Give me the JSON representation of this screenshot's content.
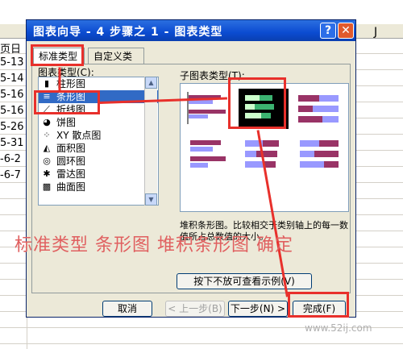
{
  "sheet": {
    "column_label": "J",
    "cells": [
      "页日",
      "5-13",
      "5-14",
      "5-16",
      "5-16",
      "5-26",
      "5-31",
      "-6-2",
      "-6-7"
    ]
  },
  "dialog": {
    "title": "图表向导 - 4 步骤之 1 - 图表类型",
    "help_glyph": "?",
    "close_glyph": "✕",
    "tabs": [
      "标准类型",
      "自定义类型"
    ],
    "chart_type_label": "图表类型(C):",
    "subtype_label": "子图表类型(T):",
    "chart_types": [
      {
        "label": "柱形图",
        "icon": "column-chart-icon"
      },
      {
        "label": "条形图",
        "icon": "bar-chart-icon"
      },
      {
        "label": "折线图",
        "icon": "line-chart-icon"
      },
      {
        "label": "饼图",
        "icon": "pie-chart-icon"
      },
      {
        "label": "XY 散点图",
        "icon": "scatter-chart-icon"
      },
      {
        "label": "面积图",
        "icon": "area-chart-icon"
      },
      {
        "label": "圆环图",
        "icon": "doughnut-chart-icon"
      },
      {
        "label": "雷达图",
        "icon": "radar-chart-icon"
      },
      {
        "label": "曲面图",
        "icon": "surface-chart-icon"
      }
    ],
    "selected_chart_type": "条形图",
    "description": "堆积条形图。比较相交于类别轴上的每一数值所占总数值的大小。",
    "preview_button": "按下不放可查看示例(V)",
    "buttons": {
      "cancel": "取消",
      "back": "< 上一步(B)",
      "next": "下一步(N) >",
      "finish": "完成(F)"
    }
  },
  "annotation_text": "标准类型 条形图 堆积条形图 确定",
  "watermark": "www.52ij.com",
  "colors": {
    "annotation": "#e8302b",
    "selection": "#316ac5",
    "titlebar": "#0b4bd1"
  }
}
